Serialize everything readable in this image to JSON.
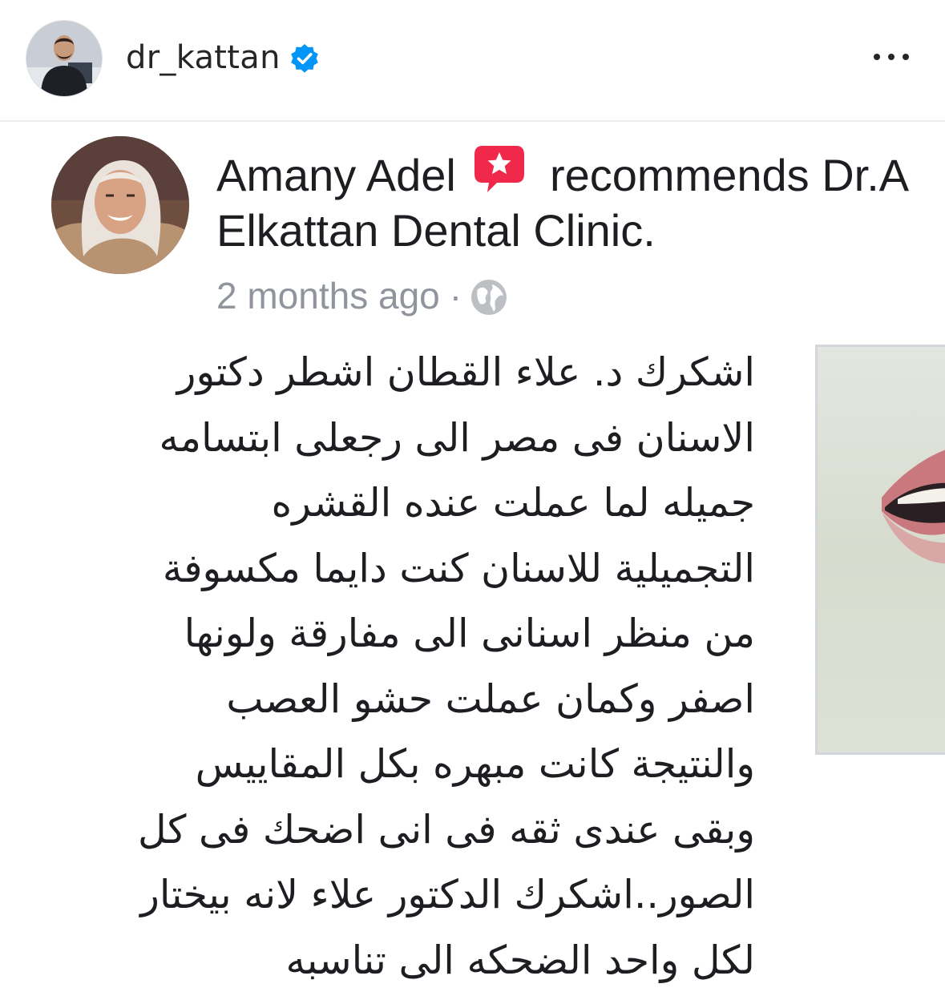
{
  "header": {
    "username": "dr_kattan",
    "avatar_icon": "profile-photo",
    "verified_icon": "verified-badge-icon",
    "more_icon": "more-options-icon"
  },
  "post": {
    "reviewer_avatar_icon": "reviewer-profile-photo",
    "reviewer_name": "Amany Adel",
    "recommend_icon": "recommendation-star-icon",
    "action_text": "recommends Dr.A",
    "page_name": "Elkattan Dental Clinic.",
    "timestamp": "2 months ago",
    "separator": "·",
    "privacy_icon": "globe-icon",
    "review_lines": [
      "اشكرك د. علاء القطان اشطر دكتور",
      "الاسنان فى مصر الى رجعلى ابتسامه",
      "جميله لما عملت عنده القشره",
      "التجميلية للاسنان كنت دايما مكسوفة",
      "من منظر اسنانى الى مفارقة ولونها",
      "اصفر وكمان عملت حشو العصب",
      "والنتيجة كانت مبهره بكل المقاييس",
      "وبقى عندى ثقه فى انى اضحك فى كل",
      "الصور..اشكرك الدكتور علاء لانه بيختار",
      "لكل واحد الضحكه الى تناسبه"
    ],
    "photo_icon": "attached-photo"
  },
  "colors": {
    "text": "#1c1e21",
    "meta_text": "#90949c",
    "username": "#262626",
    "verified_blue": "#0095f6",
    "recommend_red": "#f02849"
  }
}
